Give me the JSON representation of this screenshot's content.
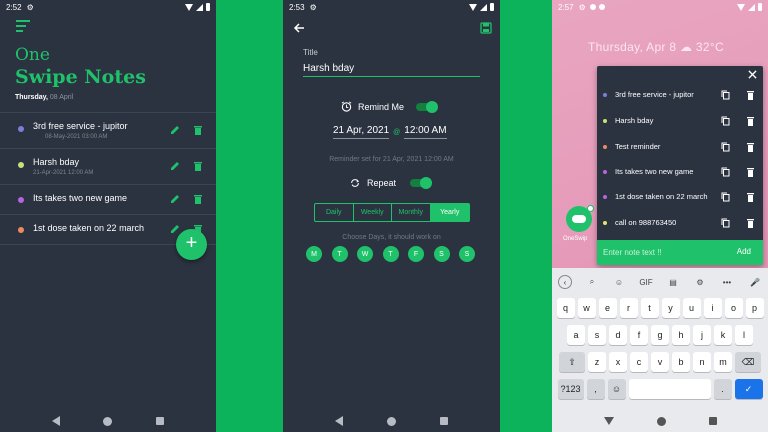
{
  "colors": {
    "accent": "#1fc26a",
    "background": "#0db35a",
    "panel": "#2b3340",
    "wallpaper": "#e9a6c0"
  },
  "screen1": {
    "status_time": "2:52",
    "app_title_line1": "One",
    "app_title_line2": "Swipe Notes",
    "date_day": "Thursday,",
    "date_rest": "08 April",
    "notes": [
      {
        "title": "3rd free service - jupitor",
        "timestamp": "08-May-2021 03:00 AM",
        "dot_color": "#7b7fd6"
      },
      {
        "title": "Harsh bday",
        "timestamp": "21-Apr-2021 12:00 AM",
        "dot_color": "#c7e27a"
      },
      {
        "title": "Its takes two new game",
        "timestamp": "",
        "dot_color": "#b664e0"
      },
      {
        "title": "1st dose taken on 22 march",
        "timestamp": "",
        "dot_color": "#f08a5d"
      }
    ],
    "fab_label": "+"
  },
  "screen2": {
    "status_time": "2:53",
    "title_label": "Title",
    "title_value": "Harsh bday",
    "remind_me_label": "Remind Me",
    "remind_me_on": true,
    "date_value": "21 Apr, 2021",
    "at_label": "@",
    "time_value": "12:00 AM",
    "reminder_set_text": "Reminder set for 21 Apr, 2021 12:00 AM",
    "repeat_label": "Repeat",
    "repeat_on": true,
    "frequency_options": [
      "Daily",
      "Weekly",
      "Monthly",
      "Yearly"
    ],
    "frequency_selected": "Yearly",
    "days_label": "Choose Days, it should work on",
    "days": [
      "M",
      "T",
      "W",
      "T",
      "F",
      "S",
      "S"
    ]
  },
  "screen3": {
    "status_time": "2:57",
    "lock_date": "Thursday, Apr 8",
    "temperature": "32°C",
    "widget_label": "OneSwip",
    "popup_notes": [
      {
        "title": "3rd free service - jupitor",
        "dot_color": "#7b7fd6"
      },
      {
        "title": "Harsh bday",
        "dot_color": "#c7e27a"
      },
      {
        "title": "Test reminder",
        "dot_color": "#f08a5d"
      },
      {
        "title": "Its takes two new game",
        "dot_color": "#b664e0"
      },
      {
        "title": "1st dose taken on 22 march",
        "dot_color": "#b664e0"
      },
      {
        "title": "call on 988763450",
        "dot_color": "#e6e36a"
      }
    ],
    "input_placeholder": "Enter note text !!",
    "add_label": "Add",
    "keyboard": {
      "toolbar": [
        "<",
        "search",
        "sticker",
        "GIF",
        "clipboard",
        "gear",
        "...",
        "mic"
      ],
      "gif_label": "GIF",
      "more_label": "•••",
      "row1": [
        "q",
        "w",
        "e",
        "r",
        "t",
        "y",
        "u",
        "i",
        "o",
        "p"
      ],
      "row2": [
        "a",
        "s",
        "d",
        "f",
        "g",
        "h",
        "j",
        "k",
        "l"
      ],
      "row3": [
        "z",
        "x",
        "c",
        "v",
        "b",
        "n",
        "m"
      ],
      "symbols_key": "?123",
      "comma_key": ",",
      "period_key": "."
    }
  }
}
